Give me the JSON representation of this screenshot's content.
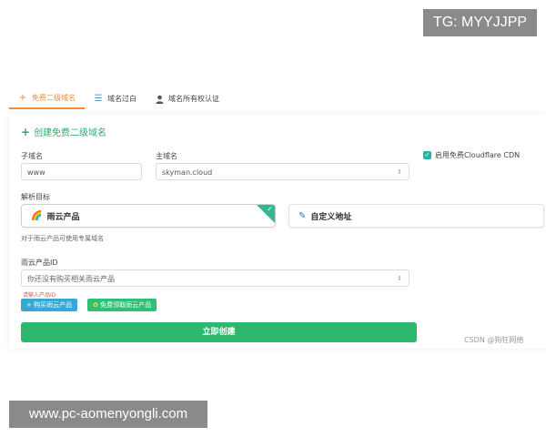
{
  "watermarks": {
    "top": "TG: MYYJJPP",
    "bottom": "www.pc-aomenyongli.com"
  },
  "tabs": [
    {
      "label": "免费二级域名",
      "icon": "plus-icon",
      "active": true
    },
    {
      "label": "域名过白",
      "icon": "list-icon",
      "active": false
    },
    {
      "label": "域名所有权认证",
      "icon": "user-icon",
      "active": false
    }
  ],
  "form": {
    "title": "创建免费二级域名",
    "subdomain": {
      "label": "子域名",
      "value": "www"
    },
    "main_domain": {
      "label": "主域名",
      "value": "skyman.cloud"
    },
    "cdn": {
      "label": "启用免费Cloudflare CDN",
      "checked": true
    },
    "target": {
      "label": "解析目标",
      "options": [
        {
          "label": "雨云产品",
          "icon": "rainbow-icon",
          "selected": true
        },
        {
          "label": "自定义地址",
          "icon": "pen-icon",
          "selected": false
        }
      ],
      "hint": "对于雨云产品可使用专属域名"
    },
    "product_id": {
      "label": "雨云产品ID",
      "placeholder": "你还没有购买相关雨云产品",
      "error": "请输入产品ID"
    },
    "buttons": {
      "buy": "+ 购买雨云产品",
      "free": "免费领取雨云产品",
      "create": "立即创建"
    }
  },
  "footer_watermark": "CSDN @狗狂网络",
  "colors": {
    "accent_orange": "#f08c3a",
    "primary_green": "#2eb86e",
    "info_blue": "#35a8d6"
  }
}
